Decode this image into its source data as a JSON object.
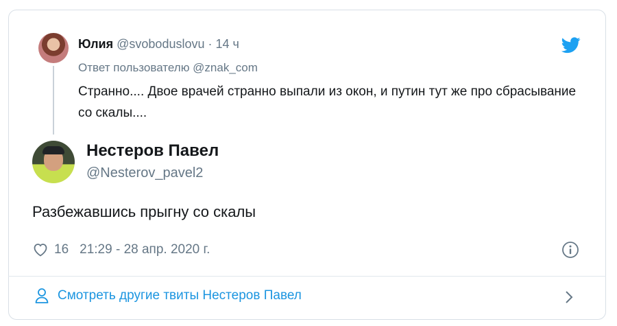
{
  "parent_tweet": {
    "author_name": "Юлия",
    "handle": "@svoboduslovu",
    "separator": "·",
    "time": "14 ч",
    "reply_to": "Ответ пользователю @znak_com",
    "text": "Странно.... Двое врачей странно выпали из окон, и путин тут же про сбрасывание со скалы...."
  },
  "tweet": {
    "author_name": "Нестеров Павел",
    "handle": "@Nesterov_pavel2",
    "text": "Разбежавшись прыгну со скалы",
    "likes": "16",
    "timestamp": "21:29 - 28 апр. 2020 г."
  },
  "footer": {
    "more_tweets": "Смотреть другие твиты Нестеров Павел"
  },
  "icons": {
    "brand": "twitter-bird-icon",
    "like": "heart-icon",
    "info": "info-icon",
    "person": "person-icon",
    "next": "chevron-right-icon"
  },
  "colors": {
    "link": "#1b95e0",
    "muted": "#657786",
    "text": "#14171a",
    "border": "#d8dfe6"
  }
}
